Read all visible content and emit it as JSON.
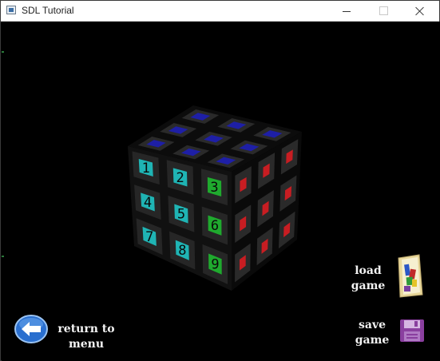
{
  "window": {
    "title": "SDL Tutorial",
    "controls": {
      "minimize": "minimize-icon",
      "maximize": "maximize-icon",
      "close": "close-icon"
    }
  },
  "game": {
    "puzzle": "3x3 numbered cube",
    "front_face_numbers": [
      "1",
      "2",
      "3",
      "4",
      "5",
      "6",
      "7",
      "8",
      "9"
    ],
    "top_face_color": "#1e1fa6",
    "right_face_color": "#c81d22",
    "front_face_colors": [
      "#1fb4b4",
      "#1fb4b4",
      "#1faa2e",
      "#1fb4b4",
      "#1fb4b4",
      "#1faa2e",
      "#1fb4b4",
      "#1fb4b4",
      "#1faa2e"
    ]
  },
  "buttons": {
    "return": {
      "line1": "return to",
      "line2": "menu",
      "icon": "back-arrow-icon"
    },
    "load": {
      "line1": "load",
      "line2": "game",
      "icon": "folder-icon"
    },
    "save": {
      "line1": "save",
      "line2": "game",
      "icon": "floppy-disk-icon"
    }
  },
  "colors": {
    "background": "#000000",
    "titlebar": "#ffffff",
    "label_text": "#f2f2f2",
    "arrow_blue": "#2f79d6",
    "floppy_purple": "#8a3f9f"
  }
}
